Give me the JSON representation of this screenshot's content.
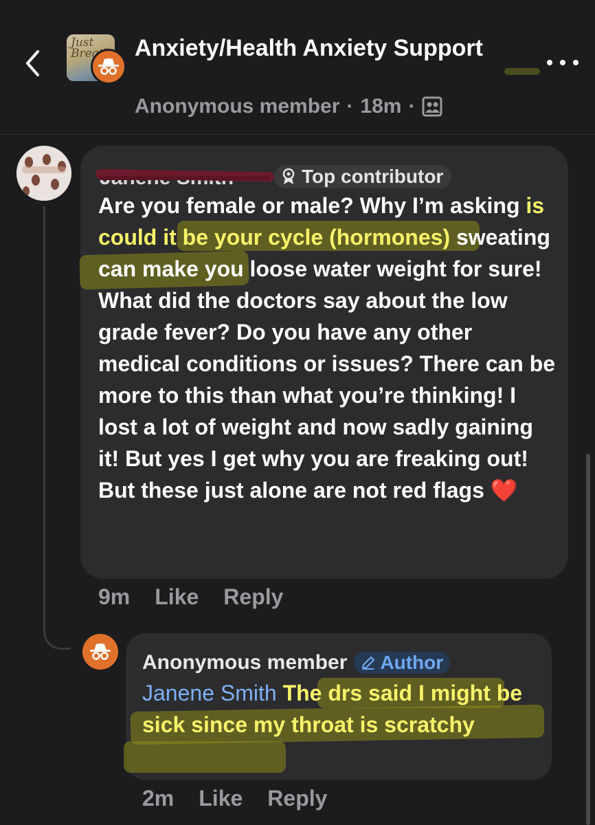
{
  "header": {
    "group_name": "Anxiety/Health Anxiety Support",
    "thumb_text": "Just Breathe",
    "poster": "Anonymous member",
    "time": "18m",
    "separator": "·"
  },
  "comment": {
    "author": "Janene Smith",
    "badge": "Top contributor",
    "text_before": "Are you female or male? Why I’m asking",
    "text_highlight": " is could it be your cycle (hormones)",
    "text_after": " sweating can make you loose water weight for sure! What did the doctors say about the low grade fever? Do you have any other medical conditions or issues? There can be more to this than what you’re thinking! I lost a lot of weight and now sadly gaining it! But yes I get why you are freaking out! But these just alone are not red flags ❤️",
    "time": "9m",
    "like": "Like",
    "reply": "Reply"
  },
  "reply": {
    "author": "Anonymous member",
    "badge": "Author",
    "mention": "Janene Smith",
    "text": " The drs said I might be sick since my throat is scratchy",
    "time": "2m",
    "like": "Like",
    "reply": "Reply"
  },
  "colors": {
    "background": "#1c1c1e",
    "bubble": "#2c2c2e",
    "anon_orange": "#e0712b",
    "highlight_text": "#f6f36a",
    "mention_blue": "#7db0f5",
    "redaction": "#6b1a2c"
  },
  "icons": [
    "back-chevron-icon",
    "anonymous-hat-glasses-icon",
    "more-dots-icon",
    "group-privacy-icon",
    "top-contributor-icon",
    "pencil-icon"
  ]
}
